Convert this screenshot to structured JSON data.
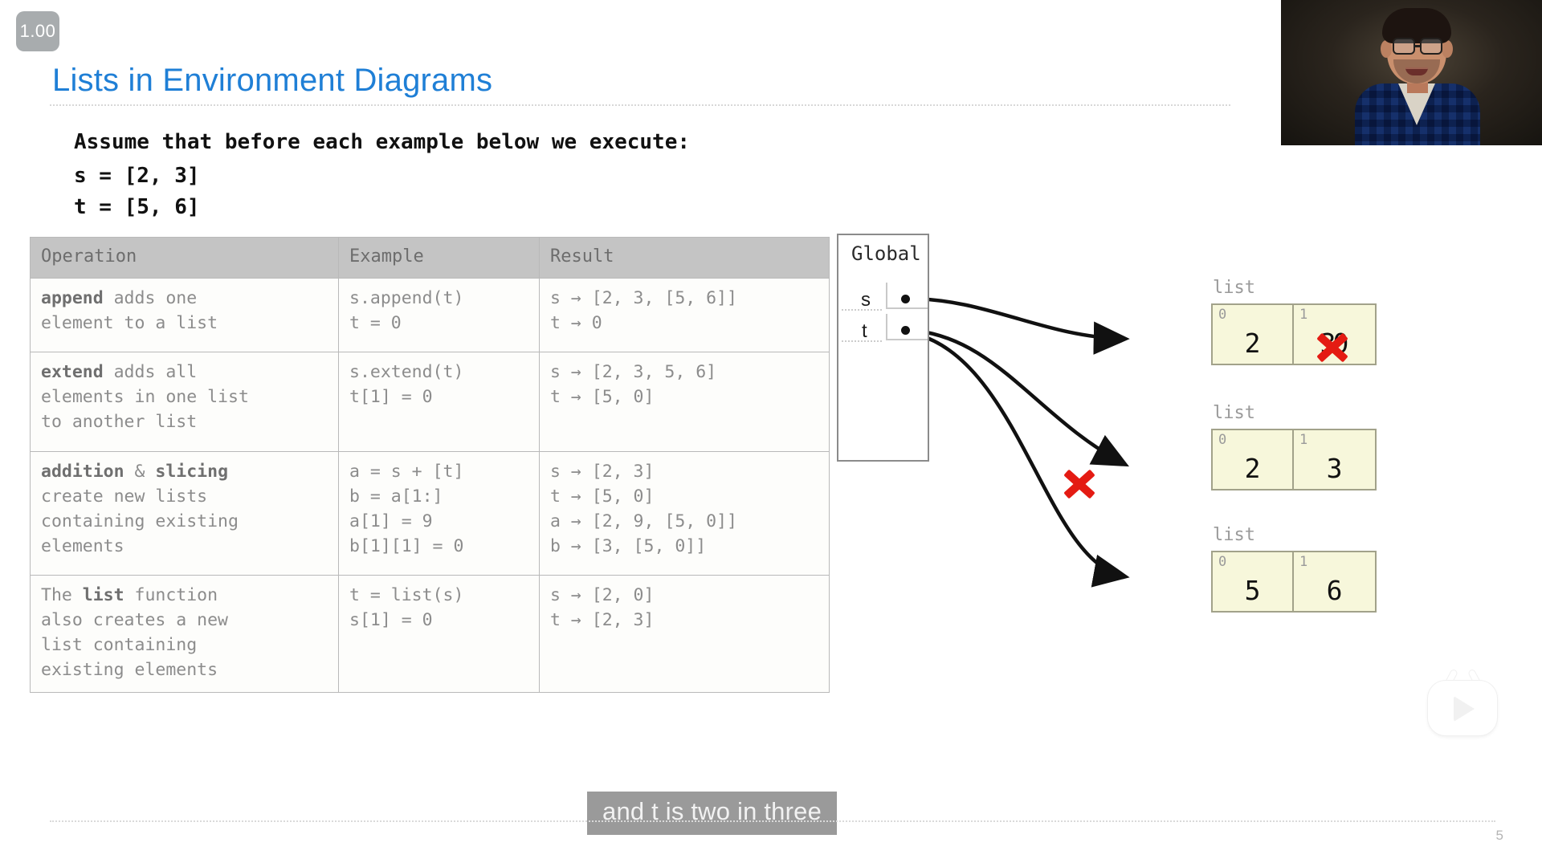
{
  "player": {
    "speed_badge": "1.00",
    "page_number": "5",
    "play_watermark_icon": "tv-play-icon"
  },
  "slide": {
    "title": "Lists in Environment Diagrams",
    "assume_heading": "Assume that before each example below we execute:",
    "assume_code": "s = [2, 3]\nt = [5, 6]"
  },
  "table": {
    "headers": [
      "Operation",
      "Example",
      "Result"
    ],
    "rows": [
      {
        "operation_bold": "append",
        "operation_rest": " adds one\nelement to a list",
        "example": "s.append(t)\nt = 0",
        "result": "s → [2, 3, [5, 6]]\nt → 0"
      },
      {
        "operation_bold": "extend",
        "operation_rest": " adds all\nelements in one list\nto another list",
        "example": "s.extend(t)\nt[1] = 0",
        "result": "s → [2, 3, 5, 6]\nt → [5, 0]"
      },
      {
        "operation_bold": "addition",
        "operation_mid": " & ",
        "operation_bold2": "slicing",
        "operation_rest": "\ncreate new lists\ncontaining existing\nelements",
        "example": "a = s + [t]\nb = a[1:]\na[1] = 9\nb[1][1] = 0",
        "result": "s → [2, 3]\nt → [5, 0]\na → [2, 9, [5, 0]]\nb → [3, [5, 0]]"
      },
      {
        "operation_pre": "The ",
        "operation_bold": "list",
        "operation_rest": " function\nalso creates a new\nlist containing\nexisting elements",
        "example": "t = list(s)\ns[1] = 0",
        "result": "s → [2, 0]\nt → [2, 3]"
      }
    ]
  },
  "environment": {
    "frame_label": "Global",
    "bindings": [
      {
        "name": "s"
      },
      {
        "name": "t"
      }
    ],
    "objects": [
      {
        "label": "list",
        "cells": [
          {
            "index": "0",
            "value": "2"
          },
          {
            "index": "1",
            "value": "0",
            "struck_value": "3",
            "struck": true
          }
        ]
      },
      {
        "label": "list",
        "cells": [
          {
            "index": "0",
            "value": "2"
          },
          {
            "index": "1",
            "value": "3"
          }
        ]
      },
      {
        "label": "list",
        "cells": [
          {
            "index": "0",
            "value": "5"
          },
          {
            "index": "1",
            "value": "6"
          }
        ]
      }
    ],
    "annotations": {
      "cell_x_mark": "red-x-mark",
      "arrow_x_mark": "red-x-mark"
    }
  },
  "caption": {
    "text": "and t is two in three"
  },
  "colors": {
    "title_blue": "#1f7fd6",
    "header_gray": "#c4c4c4",
    "list_fill": "#f7f7db",
    "red_x": "#e41b13",
    "caption_bg": "#9a9a9a"
  }
}
